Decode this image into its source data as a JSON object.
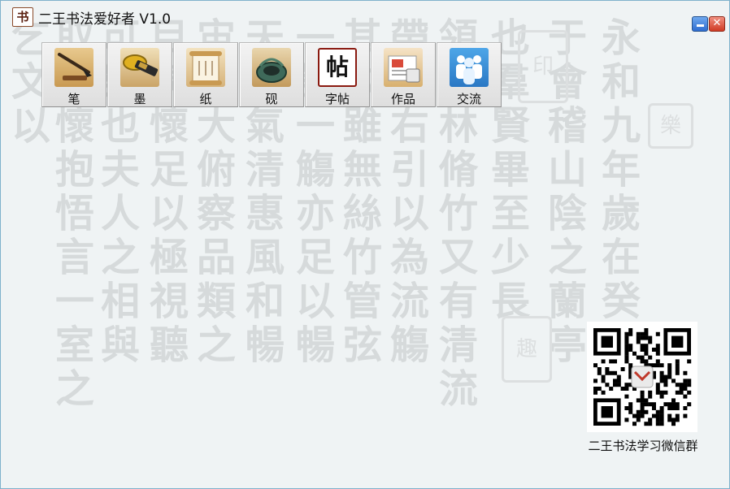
{
  "window": {
    "title": "二王书法爱好者 V1.0",
    "logo_glyph": "书",
    "minimize_icon": "minimize-icon",
    "close_icon": "close-icon",
    "close_glyph": "✕"
  },
  "toolbar": {
    "items": [
      {
        "label": "笔",
        "icon": "brush-icon"
      },
      {
        "label": "墨",
        "icon": "ink-stick-icon"
      },
      {
        "label": "纸",
        "icon": "paper-scroll-icon"
      },
      {
        "label": "砚",
        "icon": "inkstone-icon"
      },
      {
        "label": "字帖",
        "icon": "copybook-icon",
        "icon_glyph": "帖"
      },
      {
        "label": "作品",
        "icon": "works-icon"
      },
      {
        "label": "交流",
        "icon": "community-icon"
      }
    ]
  },
  "qr": {
    "label": "二王书法学习微信群",
    "icon": "qr-code-icon"
  },
  "background": {
    "columns": [
      "永和九年歲在癸",
      "于會稽山陰之蘭亭",
      "也羣賢畢至少長",
      "領茂林脩竹又有清流",
      "帶左右引以為流觴",
      "其次雖無絲竹管弦",
      "一詠一觴亦足以暢",
      "天朗氣清惠風和暢",
      "宙之大俯察品類之",
      "目騁懷足以極視聽",
      "可樂也夫人之相與",
      "取諸懷抱悟言一室之",
      "乞文以"
    ],
    "seals": [
      "印",
      "樂",
      "趣"
    ],
    "colors": {
      "text": "#d6dadb",
      "panel": "#eff3f4"
    }
  }
}
